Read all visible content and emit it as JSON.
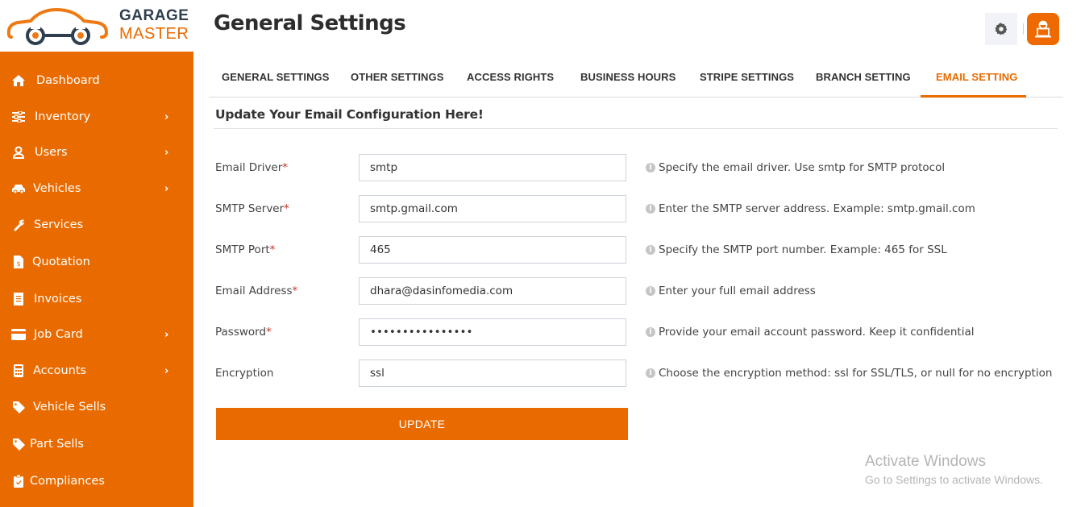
{
  "brand": {
    "line1": "GARAGE",
    "line2": "MASTER",
    "accent": "#e96b00"
  },
  "sidebar": {
    "items": [
      {
        "label": "Dashboard",
        "icon": "home-icon",
        "has_submenu": false
      },
      {
        "label": "Inventory",
        "icon": "sliders-icon",
        "has_submenu": true
      },
      {
        "label": "Users",
        "icon": "user-icon",
        "has_submenu": true
      },
      {
        "label": "Vehicles",
        "icon": "car-icon",
        "has_submenu": true
      },
      {
        "label": "Services",
        "icon": "wrench-icon",
        "has_submenu": false
      },
      {
        "label": "Quotation",
        "icon": "file-invoice-dollar-icon",
        "has_submenu": false
      },
      {
        "label": "Invoices",
        "icon": "receipt-icon",
        "has_submenu": false
      },
      {
        "label": "Job Card",
        "icon": "credit-card-icon",
        "has_submenu": true
      },
      {
        "label": "Accounts",
        "icon": "calculator-icon",
        "has_submenu": true
      },
      {
        "label": "Vehicle Sells",
        "icon": "tag-icon",
        "has_submenu": false
      },
      {
        "label": "Part Sells",
        "icon": "tag-icon",
        "has_submenu": false
      },
      {
        "label": "Compliances",
        "icon": "clipboard-check-icon",
        "has_submenu": false
      }
    ]
  },
  "header": {
    "title": "General Settings",
    "settings_icon": "gear-icon",
    "profile_icon": "user-laptop-icon"
  },
  "tabs": [
    {
      "label": "GENERAL SETTINGS",
      "active": false
    },
    {
      "label": "OTHER SETTINGS",
      "active": false
    },
    {
      "label": "ACCESS RIGHTS",
      "active": false
    },
    {
      "label": "BUSINESS HOURS",
      "active": false
    },
    {
      "label": "STRIPE SETTINGS",
      "active": false
    },
    {
      "label": "BRANCH SETTING",
      "active": false
    },
    {
      "label": "EMAIL SETTING",
      "active": true
    }
  ],
  "form": {
    "section_title": "Update Your Email Configuration Here!",
    "fields": [
      {
        "label": "Email Driver",
        "required": true,
        "value": "smtp",
        "type": "text",
        "help": "Specify the email driver. Use smtp for SMTP protocol"
      },
      {
        "label": "SMTP Server",
        "required": true,
        "value": "smtp.gmail.com",
        "type": "text",
        "help": "Enter the SMTP server address. Example: smtp.gmail.com"
      },
      {
        "label": "SMTP Port",
        "required": true,
        "value": "465",
        "type": "text",
        "help": "Specify the SMTP port number. Example: 465 for SSL"
      },
      {
        "label": "Email Address",
        "required": true,
        "value": "dhara@dasinfomedia.com",
        "type": "text",
        "help": "Enter your full email address"
      },
      {
        "label": "Password",
        "required": true,
        "value": "••••••••••••••••",
        "type": "password",
        "help": "Provide your email account password. Keep it confidential"
      },
      {
        "label": "Encryption",
        "required": false,
        "value": "ssl",
        "type": "text",
        "help": "Choose the encryption method: ssl for SSL/TLS, or null for no encryption"
      }
    ],
    "required_marker": "*",
    "submit_label": "UPDATE"
  },
  "watermark": {
    "line1": "Activate Windows",
    "line2": "Go to Settings to activate Windows."
  }
}
